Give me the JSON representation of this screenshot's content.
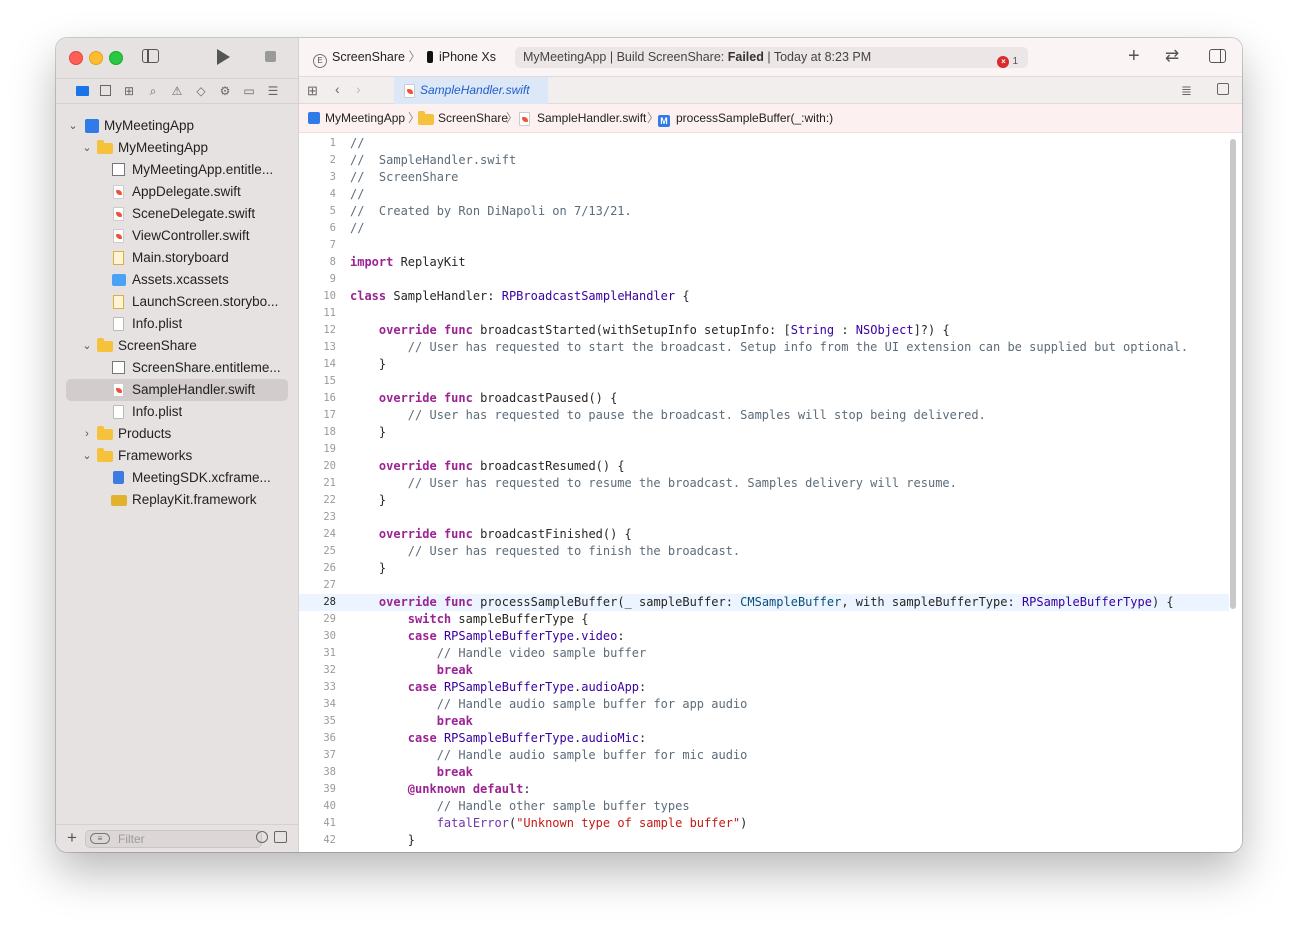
{
  "toolbar": {
    "scheme_name": "ScreenShare",
    "scheme_separator": "〉",
    "device_name": "iPhone Xs",
    "status_prefix": "MyMeetingApp | Build ScreenShare: ",
    "status_result": "Failed",
    "status_suffix": " | Today at 8:23 PM",
    "error_count": "1"
  },
  "tab": {
    "file_name": "SampleHandler.swift"
  },
  "jumpbar": {
    "items": [
      "MyMeetingApp",
      "ScreenShare",
      "SampleHandler.swift",
      "processSampleBuffer(_:with:)"
    ],
    "method_badge": "M"
  },
  "navigator": {
    "filter_placeholder": "Filter",
    "items": [
      {
        "label": "MyMeetingApp",
        "icon": "project-icon"
      },
      {
        "label": "MyMeetingApp",
        "icon": "folder-icon"
      },
      {
        "label": "MyMeetingApp.entitle...",
        "icon": "entitlements-icon"
      },
      {
        "label": "AppDelegate.swift",
        "icon": "swift-file-icon"
      },
      {
        "label": "SceneDelegate.swift",
        "icon": "swift-file-icon"
      },
      {
        "label": "ViewController.swift",
        "icon": "swift-file-icon"
      },
      {
        "label": "Main.storyboard",
        "icon": "storyboard-icon"
      },
      {
        "label": "Assets.xcassets",
        "icon": "assets-icon"
      },
      {
        "label": "LaunchScreen.storybo...",
        "icon": "storyboard-icon"
      },
      {
        "label": "Info.plist",
        "icon": "plist-icon"
      },
      {
        "label": "ScreenShare",
        "icon": "folder-icon"
      },
      {
        "label": "ScreenShare.entitleme...",
        "icon": "entitlements-icon"
      },
      {
        "label": "SampleHandler.swift",
        "icon": "swift-file-icon"
      },
      {
        "label": "Info.plist",
        "icon": "plist-icon"
      },
      {
        "label": "Products",
        "icon": "folder-icon"
      },
      {
        "label": "Frameworks",
        "icon": "folder-icon"
      },
      {
        "label": "MeetingSDK.xcframe...",
        "icon": "xcframework-icon"
      },
      {
        "label": "ReplayKit.framework",
        "icon": "framework-icon"
      }
    ]
  },
  "editor": {
    "current_line": "28",
    "lines": [
      {
        "n": "1",
        "tokens": [
          [
            "cm",
            "//"
          ]
        ]
      },
      {
        "n": "2",
        "tokens": [
          [
            "cm",
            "//  SampleHandler.swift"
          ]
        ]
      },
      {
        "n": "3",
        "tokens": [
          [
            "cm",
            "//  ScreenShare"
          ]
        ]
      },
      {
        "n": "4",
        "tokens": [
          [
            "cm",
            "//"
          ]
        ]
      },
      {
        "n": "5",
        "tokens": [
          [
            "cm",
            "//  Created by Ron DiNapoli on 7/13/21."
          ]
        ]
      },
      {
        "n": "6",
        "tokens": [
          [
            "cm",
            "//"
          ]
        ]
      },
      {
        "n": "7",
        "tokens": []
      },
      {
        "n": "8",
        "tokens": [
          [
            "kw",
            "import"
          ],
          [
            "",
            " ReplayKit"
          ]
        ]
      },
      {
        "n": "9",
        "tokens": []
      },
      {
        "n": "10",
        "tokens": [
          [
            "kw",
            "class"
          ],
          [
            "",
            " SampleHandler: "
          ],
          [
            "ty",
            "RPBroadcastSampleHandler"
          ],
          [
            "",
            " {"
          ]
        ]
      },
      {
        "n": "11",
        "tokens": []
      },
      {
        "n": "12",
        "tokens": [
          [
            "",
            "    "
          ],
          [
            "kw",
            "override"
          ],
          [
            "",
            " "
          ],
          [
            "kw",
            "func"
          ],
          [
            "",
            " broadcastStarted(withSetupInfo setupInfo: ["
          ],
          [
            "ty",
            "String"
          ],
          [
            "",
            " : "
          ],
          [
            "ty",
            "NSObject"
          ],
          [
            "",
            "]?) {"
          ]
        ]
      },
      {
        "n": "13",
        "tokens": [
          [
            "",
            "        "
          ],
          [
            "cm",
            "// User has requested to start the broadcast. Setup info from the UI extension can be supplied but optional."
          ]
        ]
      },
      {
        "n": "14",
        "tokens": [
          [
            "",
            "    }"
          ]
        ]
      },
      {
        "n": "15",
        "tokens": []
      },
      {
        "n": "16",
        "tokens": [
          [
            "",
            "    "
          ],
          [
            "kw",
            "override"
          ],
          [
            "",
            " "
          ],
          [
            "kw",
            "func"
          ],
          [
            "",
            " broadcastPaused() {"
          ]
        ]
      },
      {
        "n": "17",
        "tokens": [
          [
            "",
            "        "
          ],
          [
            "cm",
            "// User has requested to pause the broadcast. Samples will stop being delivered."
          ]
        ]
      },
      {
        "n": "18",
        "tokens": [
          [
            "",
            "    }"
          ]
        ]
      },
      {
        "n": "19",
        "tokens": []
      },
      {
        "n": "20",
        "tokens": [
          [
            "",
            "    "
          ],
          [
            "kw",
            "override"
          ],
          [
            "",
            " "
          ],
          [
            "kw",
            "func"
          ],
          [
            "",
            " broadcastResumed() {"
          ]
        ]
      },
      {
        "n": "21",
        "tokens": [
          [
            "",
            "        "
          ],
          [
            "cm",
            "// User has requested to resume the broadcast. Samples delivery will resume."
          ]
        ]
      },
      {
        "n": "22",
        "tokens": [
          [
            "",
            "    }"
          ]
        ]
      },
      {
        "n": "23",
        "tokens": []
      },
      {
        "n": "24",
        "tokens": [
          [
            "",
            "    "
          ],
          [
            "kw",
            "override"
          ],
          [
            "",
            " "
          ],
          [
            "kw",
            "func"
          ],
          [
            "",
            " broadcastFinished() {"
          ]
        ]
      },
      {
        "n": "25",
        "tokens": [
          [
            "",
            "        "
          ],
          [
            "cm",
            "// User has requested to finish the broadcast."
          ]
        ]
      },
      {
        "n": "26",
        "tokens": [
          [
            "",
            "    }"
          ]
        ]
      },
      {
        "n": "27",
        "tokens": []
      },
      {
        "n": "28",
        "tokens": [
          [
            "",
            "    "
          ],
          [
            "kw",
            "override"
          ],
          [
            "",
            " "
          ],
          [
            "kw",
            "func"
          ],
          [
            "",
            " processSampleBuffer(_ sampleBuffer: "
          ],
          [
            "tyb",
            "CMSampleBuffer"
          ],
          [
            "",
            ", with sampleBufferType: "
          ],
          [
            "ty",
            "RPSampleBufferType"
          ],
          [
            "",
            ") {"
          ]
        ]
      },
      {
        "n": "29",
        "tokens": [
          [
            "",
            "        "
          ],
          [
            "kw",
            "switch"
          ],
          [
            "",
            " sampleBufferType {"
          ]
        ]
      },
      {
        "n": "30",
        "tokens": [
          [
            "",
            "        "
          ],
          [
            "kw",
            "case"
          ],
          [
            "",
            " "
          ],
          [
            "ty",
            "RPSampleBufferType"
          ],
          [
            "",
            "."
          ],
          [
            "ty",
            "video"
          ],
          [
            "",
            ":"
          ]
        ]
      },
      {
        "n": "31",
        "tokens": [
          [
            "",
            "            "
          ],
          [
            "cm",
            "// Handle video sample buffer"
          ]
        ]
      },
      {
        "n": "32",
        "tokens": [
          [
            "",
            "            "
          ],
          [
            "kw",
            "break"
          ]
        ]
      },
      {
        "n": "33",
        "tokens": [
          [
            "",
            "        "
          ],
          [
            "kw",
            "case"
          ],
          [
            "",
            " "
          ],
          [
            "ty",
            "RPSampleBufferType"
          ],
          [
            "",
            "."
          ],
          [
            "ty",
            "audioApp"
          ],
          [
            "",
            ":"
          ]
        ]
      },
      {
        "n": "34",
        "tokens": [
          [
            "",
            "            "
          ],
          [
            "cm",
            "// Handle audio sample buffer for app audio"
          ]
        ]
      },
      {
        "n": "35",
        "tokens": [
          [
            "",
            "            "
          ],
          [
            "kw",
            "break"
          ]
        ]
      },
      {
        "n": "36",
        "tokens": [
          [
            "",
            "        "
          ],
          [
            "kw",
            "case"
          ],
          [
            "",
            " "
          ],
          [
            "ty",
            "RPSampleBufferType"
          ],
          [
            "",
            "."
          ],
          [
            "ty",
            "audioMic"
          ],
          [
            "",
            ":"
          ]
        ]
      },
      {
        "n": "37",
        "tokens": [
          [
            "",
            "            "
          ],
          [
            "cm",
            "// Handle audio sample buffer for mic audio"
          ]
        ]
      },
      {
        "n": "38",
        "tokens": [
          [
            "",
            "            "
          ],
          [
            "kw",
            "break"
          ]
        ]
      },
      {
        "n": "39",
        "tokens": [
          [
            "",
            "        "
          ],
          [
            "at",
            "@unknown"
          ],
          [
            "",
            " "
          ],
          [
            "kw",
            "default"
          ],
          [
            "",
            ":"
          ]
        ]
      },
      {
        "n": "40",
        "tokens": [
          [
            "",
            "            "
          ],
          [
            "cm",
            "// Handle other sample buffer types"
          ]
        ]
      },
      {
        "n": "41",
        "tokens": [
          [
            "",
            "            "
          ],
          [
            "fn",
            "fatalError"
          ],
          [
            "",
            "("
          ],
          [
            "st",
            "\"Unknown type of sample buffer\""
          ],
          [
            "",
            ")"
          ]
        ]
      },
      {
        "n": "42",
        "tokens": [
          [
            "",
            "        }"
          ]
        ]
      }
    ]
  }
}
